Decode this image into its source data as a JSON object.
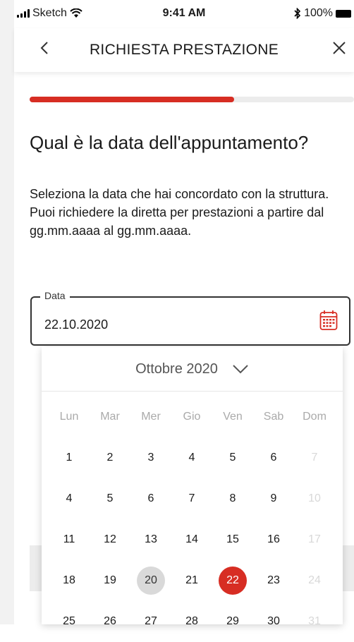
{
  "status_bar": {
    "carrier": "Sketch",
    "time": "9:41 AM",
    "battery": "100%"
  },
  "header": {
    "title": "RICHIESTA PRESTAZIONE"
  },
  "progress": {
    "fraction": 0.63,
    "color": "#d72d23"
  },
  "question": "Qual è la data dell'appuntamento?",
  "description": "Seleziona la data che hai concordato con la struttura. Puoi richiedere la diretta per prestazioni a partire dal gg.mm.aaaa al gg.mm.aaaa.",
  "date_field": {
    "label": "Data",
    "value": "22.10.2020"
  },
  "calendar": {
    "month_label": "Ottobre 2020",
    "weekdays": [
      "Lun",
      "Mar",
      "Mer",
      "Gio",
      "Ven",
      "Sab",
      "Dom"
    ],
    "weeks": [
      [
        "1",
        "2",
        "3",
        "4",
        "5",
        "6",
        "7"
      ],
      [
        "4",
        "5",
        "6",
        "7",
        "8",
        "9",
        "10"
      ],
      [
        "11",
        "12",
        "13",
        "14",
        "15",
        "16",
        "17"
      ],
      [
        "18",
        "19",
        "20",
        "21",
        "22",
        "23",
        "24"
      ],
      [
        "25",
        "26",
        "27",
        "28",
        "29",
        "30",
        "31"
      ]
    ],
    "today": "20",
    "selected": "22"
  },
  "colors": {
    "accent": "#d72d23",
    "today_bg": "#d9d9d9",
    "muted_day": "#d8d8d8"
  }
}
